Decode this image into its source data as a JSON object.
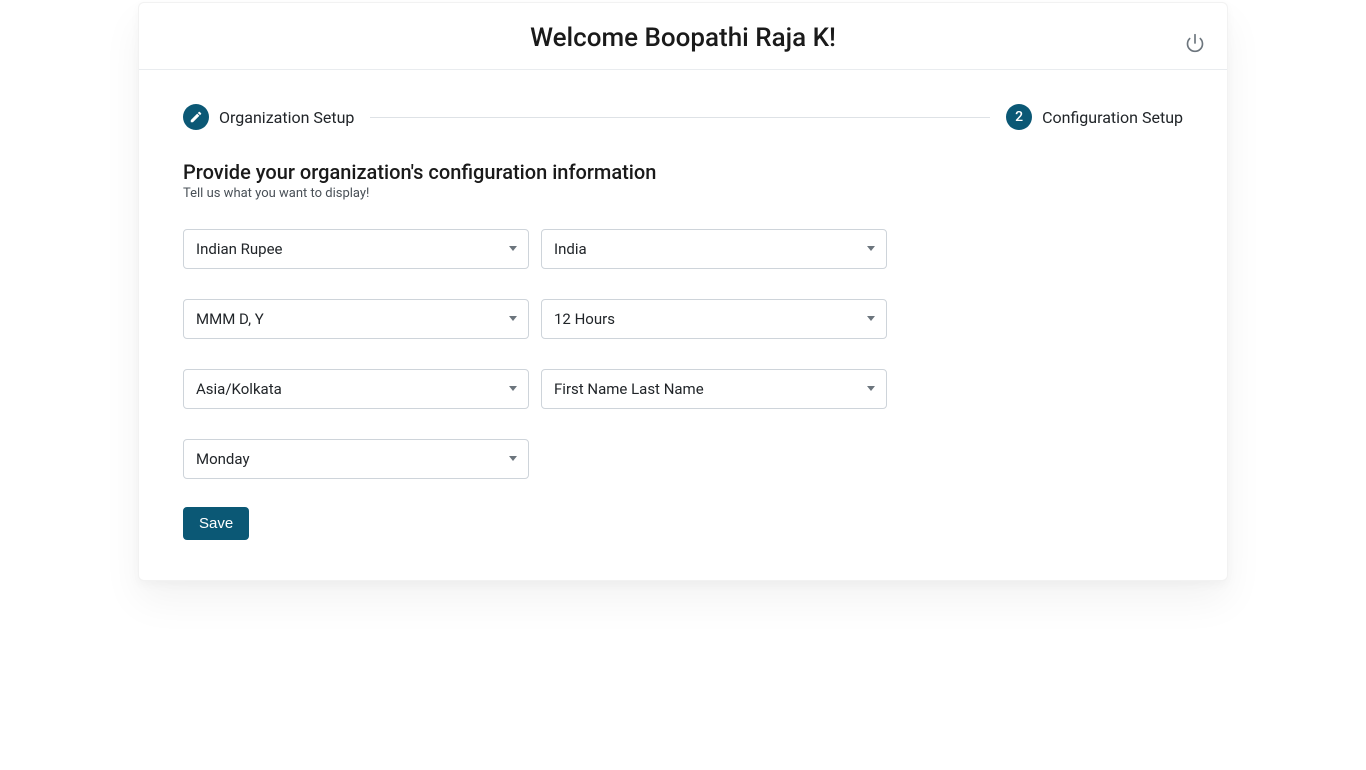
{
  "header": {
    "title": "Welcome Boopathi Raja K!"
  },
  "stepper": {
    "step1": {
      "label": "Organization Setup"
    },
    "step2": {
      "number": "2",
      "label": "Configuration Setup"
    }
  },
  "section": {
    "title": "Provide your organization's configuration information",
    "subtitle": "Tell us what you want to display!"
  },
  "fields": {
    "currency": "Indian Rupee",
    "country": "India",
    "dateFormat": "MMM D, Y",
    "timeFormat": "12 Hours",
    "timezone": "Asia/Kolkata",
    "nameFormat": "First Name Last Name",
    "weekStart": "Monday"
  },
  "buttons": {
    "save": "Save"
  },
  "colors": {
    "accent": "#0b5875"
  }
}
